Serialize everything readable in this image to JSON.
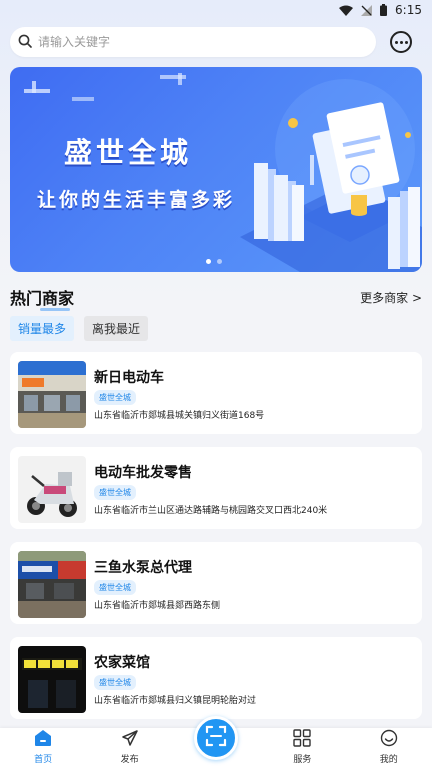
{
  "status_bar": {
    "time": "6:15"
  },
  "search": {
    "placeholder": "请输入关键字",
    "value": ""
  },
  "banner": {
    "title": "盛世全城",
    "subtitle": "让你的生活丰富多彩",
    "page_count": 2,
    "active_page": 1
  },
  "section": {
    "title": "热门商家",
    "more_label": "更多商家 >"
  },
  "filters": [
    {
      "label": "销量最多",
      "active": true
    },
    {
      "label": "离我最近",
      "active": false
    }
  ],
  "merchants": [
    {
      "name": "新日电动车",
      "tag": "盛世全城",
      "address": "山东省临沂市郯城县城关镇归义街道168号"
    },
    {
      "name": "电动车批发零售",
      "tag": "盛世全城",
      "address": "山东省临沂市兰山区通达路辅路与桃园路交叉口西北240米"
    },
    {
      "name": "三鱼水泵总代理",
      "tag": "盛世全城",
      "address": "山东省临沂市郯城县郯西路东侧"
    },
    {
      "name": "农家菜馆",
      "tag": "盛世全城",
      "address": "山东省临沂市郯城县归义镇昆明轮胎对过"
    }
  ],
  "tabbar": [
    {
      "label": "首页",
      "icon": "home-icon",
      "active": true
    },
    {
      "label": "发布",
      "icon": "send-icon",
      "active": false
    },
    {
      "label": "服务",
      "icon": "grid-icon",
      "active": false
    },
    {
      "label": "我的",
      "icon": "smile-icon",
      "active": false
    }
  ],
  "colors": {
    "accent": "#1f86e8",
    "scan_button": "#2196f3",
    "banner": "#4e83f6"
  }
}
